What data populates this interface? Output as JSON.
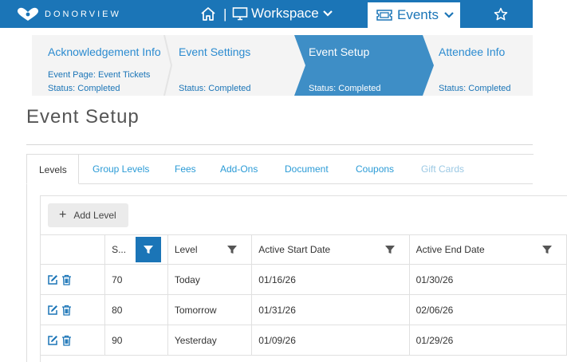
{
  "header": {
    "logo_text": "DONORVIEW",
    "workspace_label": "Workspace",
    "events_label": "Events",
    "separator": "|",
    "brand_color": "#1b75b7"
  },
  "steps": [
    {
      "title": "Acknowledgement Info",
      "sub": "Event Page: Event Tickets",
      "status": "Status: Completed",
      "active": false
    },
    {
      "title": "Event Settings",
      "sub": "",
      "status": "Status: Completed",
      "active": false
    },
    {
      "title": "Event Setup",
      "sub": "",
      "status": "Status: Completed",
      "active": true
    },
    {
      "title": "Attendee Info",
      "sub": "",
      "status": "Status: Completed",
      "active": false
    }
  ],
  "page": {
    "title": "Event Setup"
  },
  "tabs": {
    "active": "Levels",
    "items": [
      "Group Levels",
      "Fees",
      "Add-Ons",
      "Document",
      "Coupons",
      "Gift Cards"
    ]
  },
  "grid": {
    "add_label": "Add Level",
    "columns": [
      "S...",
      "Level",
      "Active Start Date",
      "Active End Date"
    ],
    "rows": [
      {
        "seq": "70",
        "level": "Today",
        "start": "01/16/26",
        "end": "01/30/26"
      },
      {
        "seq": "80",
        "level": "Tomorrow",
        "start": "01/31/26",
        "end": "02/06/26"
      },
      {
        "seq": "90",
        "level": "Yesterday",
        "start": "01/09/26",
        "end": "01/29/26"
      }
    ]
  }
}
